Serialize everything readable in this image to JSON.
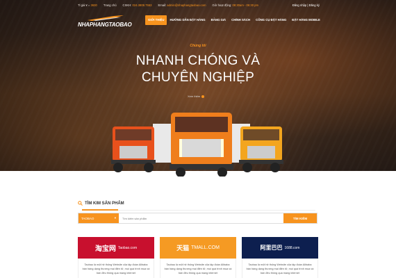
{
  "topbar": {
    "rate_label": "Tỉ giá ¥ =",
    "rate_value": "3630",
    "home": "Trang chủ",
    "cskh_label": "CSKH:",
    "cskh_value": "024.3808.7553",
    "email_label": "Email:",
    "email_value": "admin@nhaphangtaobao.com",
    "hours_label": "Giờ hoạt động:",
    "hours_value": "08:30am - 06:30 pm",
    "auth": "Đăng nhập | Đăng ký"
  },
  "logo": {
    "text": "NHAPHANGTAOBAO"
  },
  "nav": [
    "GIỚI THIỆU",
    "HƯỚNG DẪN ĐẶT HÀNG",
    "BẢNG GIÁ",
    "CHÍNH SÁCH",
    "CÔNG CỤ ĐẶT HÀNG",
    "ĐẶT HÀNG MOBILE"
  ],
  "hero": {
    "kicker": "Chúng tôi",
    "title_line1": "NHANH CHÓNG VÀ",
    "title_line2": "CHUYÊN NGHIỆP",
    "more": "Xem thêm"
  },
  "search": {
    "title": "TÌM KIM SẢN PHẨM",
    "select_value": "TAOBAO",
    "placeholder": "Tìm kiếm sản phẩm",
    "button": "TÌM KIẾM"
  },
  "cards": [
    {
      "logo_cn": "淘宝网",
      "logo_en": "Taobao.com",
      "color": "#c8102e",
      "text": "Taobao là một hệ thống Website của tập đoàn Alibaba bán hàng dạng thương mại điện tử, mọi quá trình mua và bán đều thông qua mạng internet"
    },
    {
      "logo_cn": "天猫",
      "logo_en": "TMALL.COM",
      "color": "#f59a23",
      "text": "Taobao là một hệ thống Website của tập đoàn Alibaba bán hàng dạng thương mại điện tử, mọi quá trình mua và bán đều thông qua mạng internet"
    },
    {
      "logo_cn": "阿里巴巴",
      "logo_en": "1688.com",
      "color": "#0d1f4f",
      "text": "Taobao là một hệ thống Website của tập đoàn Alibaba bán hàng dạng thương mại điện tử, mọi quá trình mua và bán đều thông qua mạng internet"
    }
  ],
  "colors": {
    "accent": "#f7931e"
  }
}
